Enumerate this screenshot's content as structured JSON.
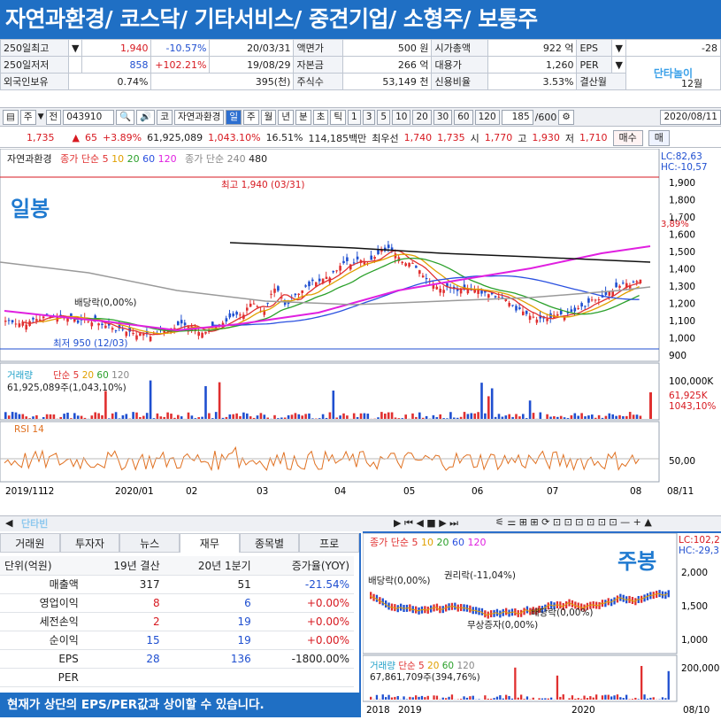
{
  "banner": {
    "title": "자연과환경/ 코스닥/ 기타서비스/ 중견기업/ 소형주/ 보통주"
  },
  "info": {
    "row1": {
      "label1": "250일최고",
      "price": "1,940",
      "pct": "-10.57%",
      "date": "20/03/31",
      "label2": "액면가",
      "v2": "500 원",
      "label3": "시가총액",
      "v3": "922 억",
      "label4": "EPS",
      "v4": "-28"
    },
    "row2": {
      "label1": "250일저저",
      "price": "858",
      "pct": "+102.21%",
      "date": "19/08/29",
      "label2": "자본금",
      "v2": "266 억",
      "label3": "대용가",
      "v3": "1,260",
      "label4": "PER",
      "v4": ""
    },
    "row3": {
      "label1": "외국인보유",
      "v1": "0.74%",
      "v1b": "395(천)",
      "label2": "주식수",
      "v2": "53,149 천",
      "label3": "신용비율",
      "v3": "3.53%",
      "label4": "결산월",
      "v4": "12월"
    },
    "logo": "단타놀이"
  },
  "toolbar": {
    "stock_type": "주",
    "whole": "전",
    "code": "043910",
    "name_btn": "코",
    "name": "자연과환경",
    "periods": [
      "일",
      "주",
      "월",
      "년",
      "분",
      "초",
      "틱"
    ],
    "minutes": [
      "1",
      "3",
      "5",
      "10",
      "20",
      "30",
      "60",
      "120"
    ],
    "count": "185",
    "count_total": "/600",
    "date": "2020/08/11"
  },
  "quote": {
    "price": "1,735",
    "change": "65",
    "pct": "+3.89%",
    "volume": "61,925,089",
    "vol_pct": "1,043.10%",
    "turnover": "16.51%",
    "amount": "114,185백만",
    "best_sell_label": "최우선",
    "best_sell": "1,740",
    "best_buy": "1,735",
    "open_label": "시",
    "open": "1,770",
    "high_label": "고",
    "high": "1,930",
    "low_label": "저",
    "low": "1,710",
    "buy_btn": "매수",
    "extra_btn": "매"
  },
  "daily": {
    "price_legend": {
      "name": "자연과환경",
      "ma_label": "종가 단순",
      "ma": [
        "5",
        "10",
        "20",
        "60",
        "120"
      ],
      "ma2_label": "종가 단순",
      "ma2": [
        "240",
        "480"
      ]
    },
    "label": "일봉",
    "annotations": {
      "high": "최고 1,940 (03/31)",
      "low": "최저 950 (12/03)",
      "dividend": "배당락(0,00%)"
    },
    "lc": "LC:82,63",
    "hc": "HC:-10,57",
    "price_ticks": [
      "1,900",
      "1,800",
      "1,700",
      "1,600",
      "1,500",
      "1,400",
      "1,300",
      "1,200",
      "1,100",
      "1,000",
      "900"
    ],
    "price_marker": "1,735",
    "price_marker_pct": "3,89%",
    "volume_legend": {
      "name": "거래량",
      "ma_label": "단순",
      "ma": [
        "5",
        "20",
        "60",
        "120"
      ],
      "value": "61,925,089주(1,043,10%)"
    },
    "volume_ticks": [
      "100,000K"
    ],
    "volume_marker": "61,925K",
    "volume_marker_pct": "1043,10%",
    "rsi_legend": "RSI 14",
    "rsi_tick": "50,00",
    "x_labels": [
      "2019/11",
      "12",
      "2020/01",
      "02",
      "03",
      "04",
      "05",
      "06",
      "07",
      "08",
      "08/11"
    ]
  },
  "bottom_tabs": [
    "거래원",
    "투자자",
    "뉴스",
    "재무",
    "종목별",
    "프로"
  ],
  "fin_table": {
    "headers": [
      "단위(억원)",
      "19년 결산",
      "20년 1분기",
      "증가율(YOY)"
    ],
    "rows": [
      [
        "매출액",
        "317",
        "51",
        "-21.54%"
      ],
      [
        "영업이익",
        "8",
        "6",
        "+0.00%"
      ],
      [
        "세전손익",
        "2",
        "19",
        "+0.00%"
      ],
      [
        "순이익",
        "15",
        "19",
        "+0.00%"
      ],
      [
        "EPS",
        "28",
        "136",
        "-1800.00%"
      ],
      [
        "PER",
        "",
        "",
        ""
      ]
    ]
  },
  "notice": "현재가 상단의 EPS/PER값과 상이할 수 있습니다.",
  "weekly": {
    "label": "주봉",
    "legend": {
      "ma_label": "종가 단순",
      "ma": [
        "5",
        "10",
        "20",
        "60",
        "120"
      ]
    },
    "lc": "LC:102,2",
    "hc": "HC:-29,3",
    "ticks": [
      "2,000",
      "1,500",
      "1,000"
    ],
    "annotations": {
      "a1": "배당락(0,00%)",
      "a2": "권리락(-11,04%)",
      "a3": "무상증자(0,00%)",
      "a4": "배당락(0,00%)"
    },
    "volume_legend": {
      "name": "거래량",
      "ma_label": "단순",
      "ma": [
        "5",
        "20",
        "60",
        "120"
      ],
      "value": "67,861,709주(394,76%)"
    },
    "volume_tick": "200,000",
    "x_labels": [
      "2018",
      "2019",
      "2020",
      "08/10"
    ]
  },
  "colors": {
    "banner": "#1f6fc4",
    "up": "#d71920",
    "down": "#1f4fd0",
    "ma5": "#e03030",
    "ma10": "#e0a000",
    "ma20": "#2aa02a",
    "ma60": "#2a50e0",
    "ma120": "#e020e0"
  }
}
